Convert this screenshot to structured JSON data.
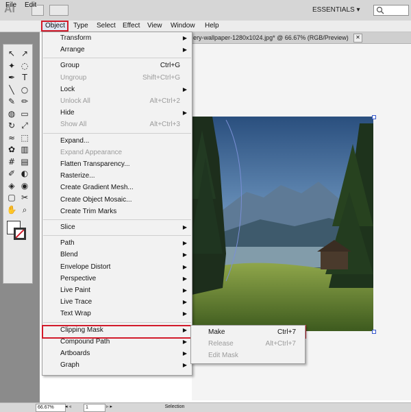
{
  "app": {
    "logo_text": "Ai",
    "workspace": "ESSENTIALS"
  },
  "menubar": [
    "File",
    "Edit",
    "Object",
    "Type",
    "Select",
    "Effect",
    "View",
    "Window",
    "Help"
  ],
  "document": {
    "tab_title": "ery-wallpaper-1280x1024.jpg* @ 66.67% (RGB/Preview)",
    "close_glyph": "✕"
  },
  "object_menu": {
    "groups": [
      [
        {
          "label": "Transform",
          "shortcut": "",
          "submenu": true,
          "disabled": false
        },
        {
          "label": "Arrange",
          "shortcut": "",
          "submenu": true,
          "disabled": false
        }
      ],
      [
        {
          "label": "Group",
          "shortcut": "Ctrl+G",
          "submenu": false,
          "disabled": false
        },
        {
          "label": "Ungroup",
          "shortcut": "Shift+Ctrl+G",
          "submenu": false,
          "disabled": true
        },
        {
          "label": "Lock",
          "shortcut": "",
          "submenu": true,
          "disabled": false
        },
        {
          "label": "Unlock All",
          "shortcut": "Alt+Ctrl+2",
          "submenu": false,
          "disabled": true
        },
        {
          "label": "Hide",
          "shortcut": "",
          "submenu": true,
          "disabled": false
        },
        {
          "label": "Show All",
          "shortcut": "Alt+Ctrl+3",
          "submenu": false,
          "disabled": true
        }
      ],
      [
        {
          "label": "Expand...",
          "shortcut": "",
          "submenu": false,
          "disabled": false
        },
        {
          "label": "Expand Appearance",
          "shortcut": "",
          "submenu": false,
          "disabled": true
        },
        {
          "label": "Flatten Transparency...",
          "shortcut": "",
          "submenu": false,
          "disabled": false
        },
        {
          "label": "Rasterize...",
          "shortcut": "",
          "submenu": false,
          "disabled": false
        },
        {
          "label": "Create Gradient Mesh...",
          "shortcut": "",
          "submenu": false,
          "disabled": false
        },
        {
          "label": "Create Object Mosaic...",
          "shortcut": "",
          "submenu": false,
          "disabled": false
        },
        {
          "label": "Create Trim Marks",
          "shortcut": "",
          "submenu": false,
          "disabled": false
        }
      ],
      [
        {
          "label": "Slice",
          "shortcut": "",
          "submenu": true,
          "disabled": false
        }
      ],
      [
        {
          "label": "Path",
          "shortcut": "",
          "submenu": true,
          "disabled": false
        },
        {
          "label": "Blend",
          "shortcut": "",
          "submenu": true,
          "disabled": false
        },
        {
          "label": "Envelope Distort",
          "shortcut": "",
          "submenu": true,
          "disabled": false
        },
        {
          "label": "Perspective",
          "shortcut": "",
          "submenu": true,
          "disabled": false
        },
        {
          "label": "Live Paint",
          "shortcut": "",
          "submenu": true,
          "disabled": false
        },
        {
          "label": "Live Trace",
          "shortcut": "",
          "submenu": true,
          "disabled": false
        },
        {
          "label": "Text Wrap",
          "shortcut": "",
          "submenu": true,
          "disabled": false
        }
      ],
      [
        {
          "label": "Clipping Mask",
          "shortcut": "",
          "submenu": true,
          "disabled": false
        },
        {
          "label": "Compound Path",
          "shortcut": "",
          "submenu": true,
          "disabled": false
        },
        {
          "label": "Artboards",
          "shortcut": "",
          "submenu": true,
          "disabled": false
        },
        {
          "label": "Graph",
          "shortcut": "",
          "submenu": true,
          "disabled": false
        }
      ]
    ]
  },
  "clipping_submenu": [
    {
      "label": "Make",
      "shortcut": "Ctrl+7",
      "disabled": false
    },
    {
      "label": "Release",
      "shortcut": "Alt+Ctrl+7",
      "disabled": true
    },
    {
      "label": "Edit Mask",
      "shortcut": "",
      "disabled": true
    }
  ],
  "statusbar": {
    "zoom": "66.67%",
    "artboard": "1",
    "mode": "Selection"
  },
  "colors": {
    "highlight_border": "#d21a2a",
    "menu_bg": "#f2f2f2",
    "disabled_text": "#9b9b9b"
  }
}
